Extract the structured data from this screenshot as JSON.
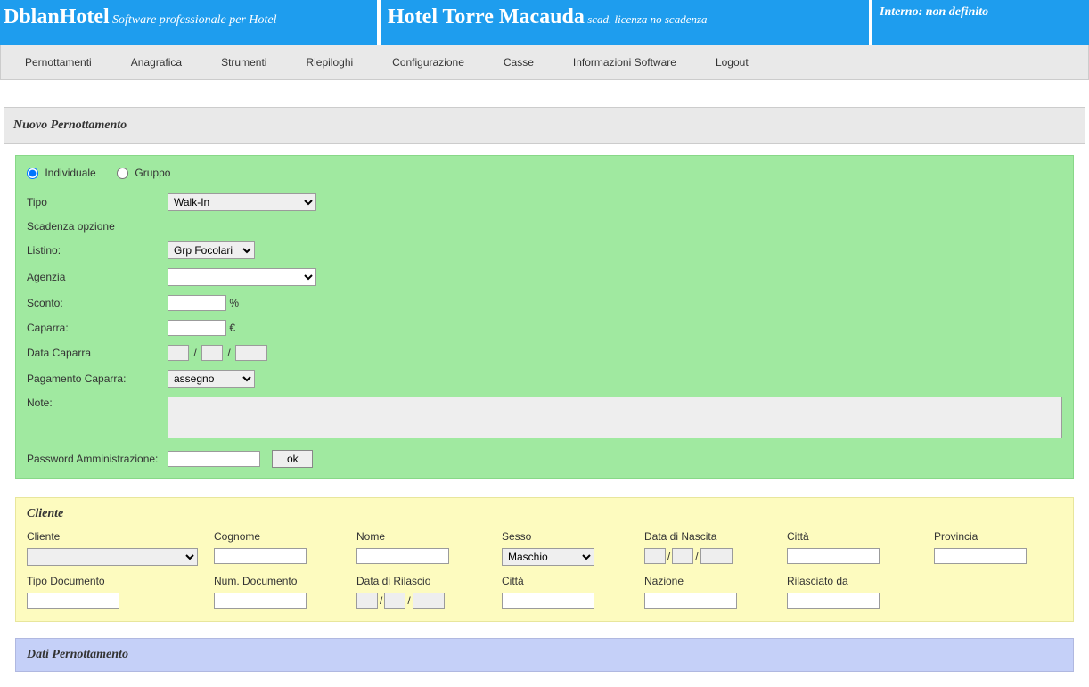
{
  "header": {
    "app_name": "DblanHotel",
    "tagline": "Software professionale per Hotel",
    "hotel_name": "Hotel Torre Macauda",
    "license": "scad. licenza no scadenza",
    "interno": "Interno: non definito"
  },
  "menu": {
    "items": [
      "Pernottamenti",
      "Anagrafica",
      "Strumenti",
      "Riepiloghi",
      "Configurazione",
      "Casse",
      "Informazioni Software",
      "Logout"
    ]
  },
  "page": {
    "title": "Nuovo Pernottamento"
  },
  "booking": {
    "radio_individuale": "Individuale",
    "radio_gruppo": "Gruppo",
    "tipo_label": "Tipo",
    "tipo_value": "Walk-In",
    "scadenza_label": "Scadenza opzione",
    "listino_label": "Listino:",
    "listino_value": "Grp Focolari",
    "agenzia_label": "Agenzia",
    "agenzia_value": "",
    "sconto_label": "Sconto:",
    "sconto_value": "",
    "sconto_unit": "%",
    "caparra_label": "Caparra:",
    "caparra_value": "",
    "caparra_unit": "€",
    "data_caparra_label": "Data Caparra",
    "pagamento_caparra_label": "Pagamento Caparra:",
    "pagamento_caparra_value": "assegno",
    "note_label": "Note:",
    "note_value": "",
    "password_label": "Password Amministrazione:",
    "ok_label": "ok",
    "date": {
      "d": "",
      "m": "",
      "y": "",
      "sep": "/"
    }
  },
  "cliente": {
    "heading": "Cliente",
    "labels": {
      "cliente": "Cliente",
      "cognome": "Cognome",
      "nome": "Nome",
      "sesso": "Sesso",
      "data_nascita": "Data di Nascita",
      "citta": "Città",
      "provincia": "Provincia",
      "tipo_documento": "Tipo Documento",
      "num_documento": "Num. Documento",
      "data_rilascio": "Data di Rilascio",
      "citta2": "Città",
      "nazione": "Nazione",
      "rilasciato_da": "Rilasciato da"
    },
    "sesso_value": "Maschio",
    "date": {
      "sep": "/"
    }
  },
  "dati": {
    "heading": "Dati Pernottamento"
  }
}
